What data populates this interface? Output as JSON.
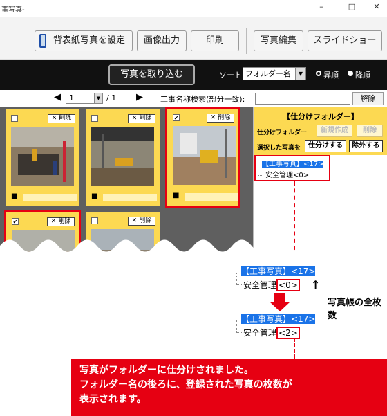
{
  "window": {
    "title": "事写真-",
    "controls": [
      "–",
      "□",
      "✕"
    ]
  },
  "toolbar": {
    "buttons": [
      "背表紙写真を設定",
      "画像出力",
      "印刷",
      "写真編集",
      "スライドショー"
    ]
  },
  "actionbar": {
    "import_label": "写真を取り込む",
    "sort_label": "ソート",
    "sort_value": "フォルダー名",
    "order": [
      {
        "label": "昇順",
        "selected": true
      },
      {
        "label": "降順",
        "selected": false
      }
    ]
  },
  "nav": {
    "page_value": "1",
    "page_total": "/ 1",
    "search_label": "工事名称検索(部分一致):",
    "clear_label": "解除"
  },
  "cards": [
    {
      "checked": false,
      "delete_label": "✕ 削除",
      "selected": false
    },
    {
      "checked": false,
      "delete_label": "✕ 削除",
      "selected": false
    },
    {
      "checked": true,
      "delete_label": "✕ 削除",
      "selected": true
    },
    {
      "checked": true,
      "delete_label": "✕ 削除",
      "selected": true
    },
    {
      "checked": false,
      "delete_label": "✕ 削除",
      "selected": false
    }
  ],
  "folder_panel": {
    "title": "【仕分けフォルダー】",
    "folder_label": "仕分けフォルダー",
    "new_label": "新規作成",
    "delete_label": "削除",
    "selected_label": "選択した写真を",
    "assign_label": "仕分けする",
    "remove_label": "除外する",
    "tree_root": "【工事写真】",
    "tree_root_count": "<17>",
    "tree_child": "安全管理",
    "tree_child_count": "<0>"
  },
  "annotation": {
    "before_root": "【工事写真】",
    "before_root_count": "<17>",
    "before_child": "安全管理",
    "before_child_count": "<0>",
    "callout": "写真帳の全枚数",
    "after_root": "【工事写真】",
    "after_root_count": "<17>",
    "after_child": "安全管理",
    "after_child_count": "<2>",
    "message_line1": "写真がフォルダーに仕分けされました。",
    "message_line2": "フォルダー名の後ろに、登録された写真の枚数が",
    "message_line3": "表示されます。"
  },
  "colors": {
    "accent_red": "#e60012",
    "card_yellow": "#fcd952",
    "highlight_blue": "#1a73e8"
  }
}
